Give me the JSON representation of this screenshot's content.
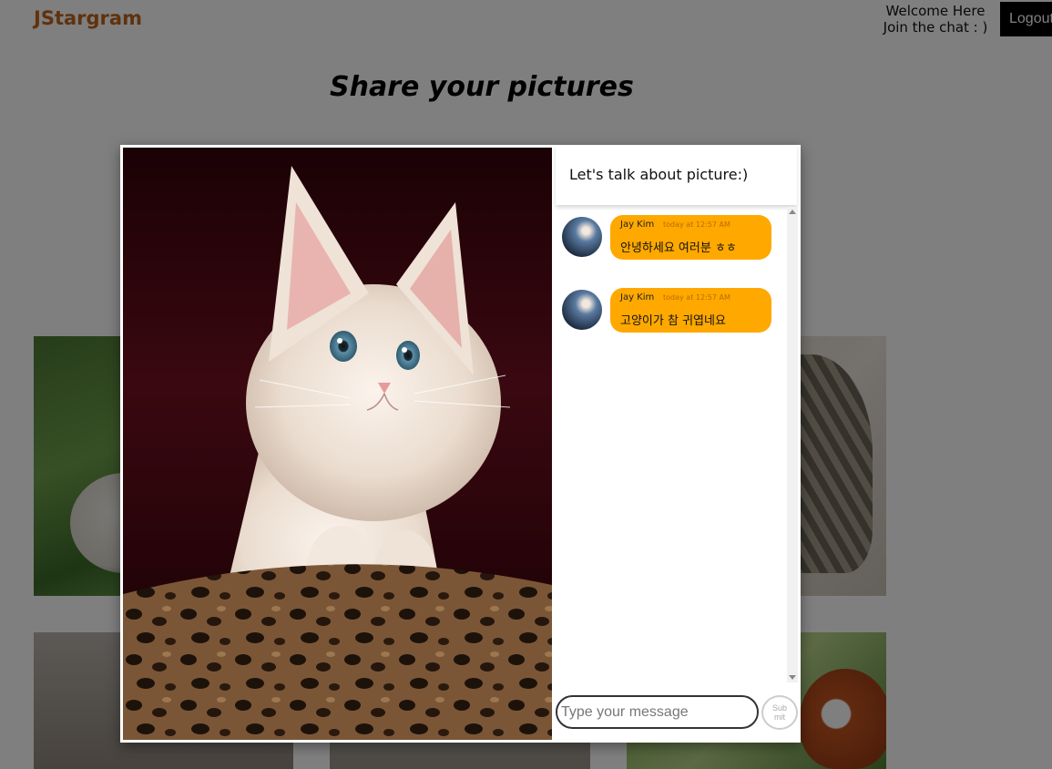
{
  "header": {
    "logo": "JStargram",
    "welcome_line1": "Welcome Here",
    "welcome_line2": "Join the chat : )",
    "logout_label": "Logout"
  },
  "page": {
    "title": "Share your pictures"
  },
  "gallery": {
    "thumbnails": [
      "cat-on-grass",
      "tabby-cat-lying",
      "animal-photo",
      "animal-photo",
      "red-panda"
    ]
  },
  "modal": {
    "photo": "kitten-in-leopard-basket",
    "chat": {
      "title": "Let's talk about picture:)",
      "messages": [
        {
          "user": "Jay Kim",
          "time": "today at 12:57 AM",
          "text": "안녕하세요 여러분 ㅎㅎ"
        },
        {
          "user": "Jay Kim",
          "time": "today at 12:57 AM",
          "text": "고양이가 참 귀엽네요"
        }
      ],
      "input_placeholder": "Type your message",
      "submit_label": "Sub mit"
    }
  },
  "colors": {
    "logo": "#c0651c",
    "bubble": "#ffa800",
    "overlay": "rgba(0,0,0,0.5)"
  }
}
